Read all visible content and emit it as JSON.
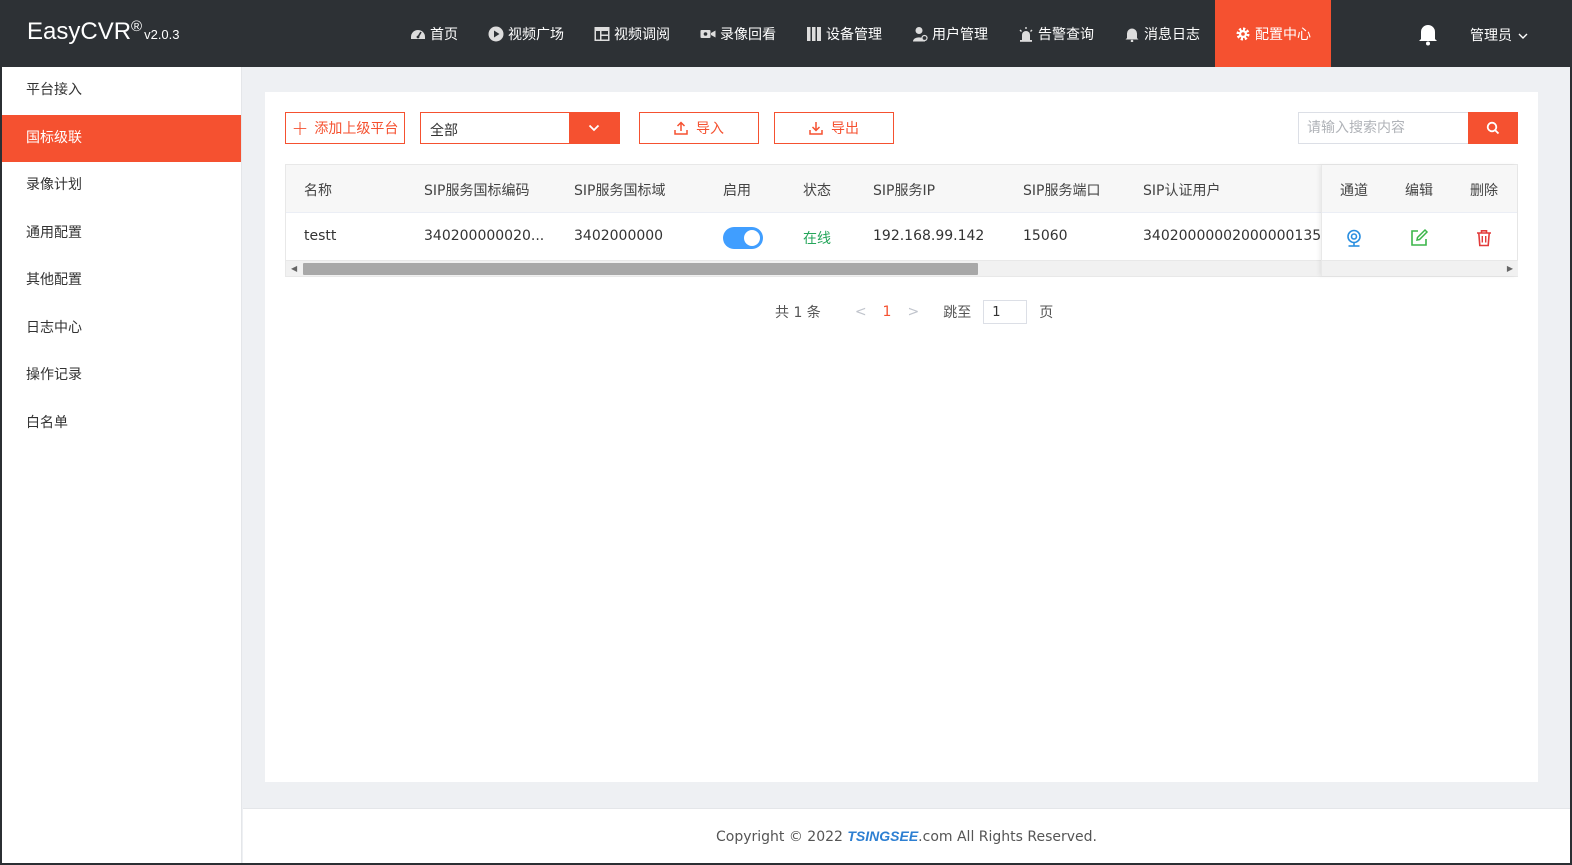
{
  "app": {
    "name": "EasyCVR",
    "reg": "®",
    "version": "v2.0.3"
  },
  "nav": [
    {
      "label": "首页",
      "icon": "dashboard-icon"
    },
    {
      "label": "视频广场",
      "icon": "play-circle-icon"
    },
    {
      "label": "视频调阅",
      "icon": "layout-icon"
    },
    {
      "label": "录像回看",
      "icon": "video-camera-icon"
    },
    {
      "label": "设备管理",
      "icon": "device-icon"
    },
    {
      "label": "用户管理",
      "icon": "user-icon"
    },
    {
      "label": "告警查询",
      "icon": "alarm-icon"
    },
    {
      "label": "消息日志",
      "icon": "bell-icon"
    },
    {
      "label": "配置中心",
      "icon": "gear-icon",
      "active": true
    }
  ],
  "user": {
    "label": "管理员"
  },
  "sidebar": [
    {
      "label": "平台接入"
    },
    {
      "label": "国标级联",
      "active": true
    },
    {
      "label": "录像计划"
    },
    {
      "label": "通用配置"
    },
    {
      "label": "其他配置"
    },
    {
      "label": "日志中心"
    },
    {
      "label": "操作记录"
    },
    {
      "label": "白名单"
    }
  ],
  "toolbar": {
    "add_label": "添加上级平台",
    "filter_value": "全部",
    "import_label": "导入",
    "export_label": "导出",
    "search_placeholder": "请输入搜索内容"
  },
  "table": {
    "headers": {
      "name": "名称",
      "sip_code": "SIP服务国标编码",
      "sip_domain": "SIP服务国标域",
      "enabled": "启用",
      "status": "状态",
      "sip_ip": "SIP服务IP",
      "sip_port": "SIP服务端口",
      "sip_user": "SIP认证用户",
      "channel": "通道",
      "edit": "编辑",
      "delete": "删除"
    },
    "rows": [
      {
        "name": "testt",
        "sip_code": "340200000020...",
        "sip_domain": "3402000000",
        "enabled": true,
        "status": "在线",
        "sip_ip": "192.168.99.142",
        "sip_port": "15060",
        "sip_user": "34020000002000000135"
      }
    ]
  },
  "pagination": {
    "total_text": "共 1 条",
    "prev": "<",
    "current": "1",
    "next": ">",
    "goto_label": "跳至",
    "goto_value": "1",
    "page_suffix": "页"
  },
  "footer": {
    "prefix": "Copyright © 2022 ",
    "brand": "TSINGSEE",
    "suffix": ".com All Rights Reserved."
  },
  "colors": {
    "accent": "#f55130",
    "topbar": "#2d3135",
    "online": "#26a65b",
    "toggle": "#409eff"
  }
}
